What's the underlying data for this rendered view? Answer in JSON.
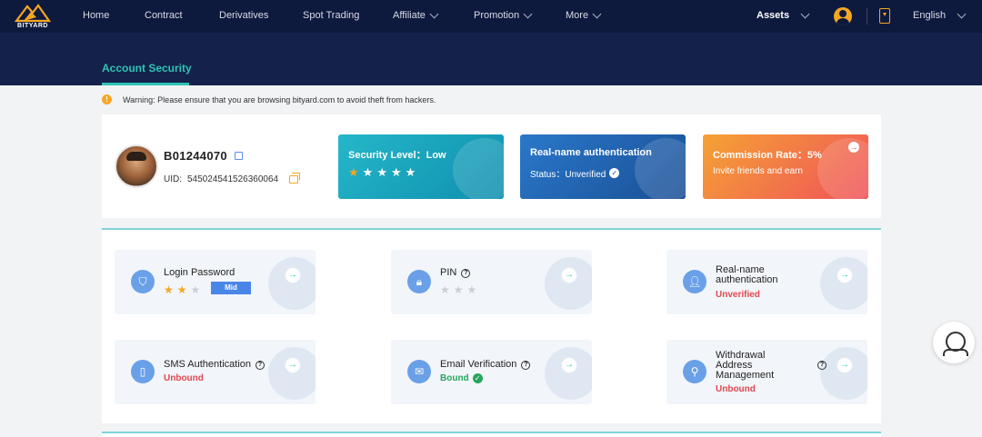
{
  "brand": {
    "name": "BITYARD",
    "logo_icon": "mountain-logo-icon",
    "accent": "#f5a623"
  },
  "nav": {
    "items": [
      {
        "label": "Home",
        "has_dropdown": false
      },
      {
        "label": "Contract",
        "has_dropdown": false
      },
      {
        "label": "Derivatives",
        "has_dropdown": false
      },
      {
        "label": "Spot Trading",
        "has_dropdown": false
      },
      {
        "label": "Affiliate",
        "has_dropdown": true
      },
      {
        "label": "Promotion",
        "has_dropdown": true
      },
      {
        "label": "More",
        "has_dropdown": true
      }
    ],
    "assets_label": "Assets",
    "language": "English"
  },
  "subheader": {
    "active_tab": "Account Security",
    "accent": "#2ec4b6"
  },
  "warning": {
    "text": "Warning: Please ensure that you are browsing bityard.com to avoid theft from hackers.",
    "icon": "warning-icon"
  },
  "profile": {
    "username": "B01244070",
    "uid_label": "UID:",
    "uid_value": "5450245415263600​64"
  },
  "banners": {
    "security": {
      "title": "Security Level：Low",
      "stars_filled": 1,
      "stars_total": 5
    },
    "realname": {
      "title": "Real-name authentication",
      "status": "Status：Unverified"
    },
    "commission": {
      "title": "Commission Rate：5%",
      "subtitle": "Invite friends and earn"
    }
  },
  "tiles": {
    "login_password": {
      "title": "Login Password",
      "stars_filled": 2,
      "stars_total": 3,
      "level": "Mid",
      "icon": "shield-icon"
    },
    "pin": {
      "title": "PIN",
      "stars_filled": 0,
      "stars_total": 3,
      "icon": "lock-icon"
    },
    "realname": {
      "title_line1": "Real-name",
      "title_line2": "authentication",
      "status": "Unverified",
      "icon": "user-icon"
    },
    "sms": {
      "title": "SMS Authentication",
      "status": "Unbound",
      "icon": "phone-icon"
    },
    "email": {
      "title": "Email Verification",
      "status": "Bound",
      "icon": "mail-icon"
    },
    "withdrawal": {
      "title_line1": "Withdrawal",
      "title_line2": "Address",
      "title_line3": "Management",
      "status": "Unbound",
      "icon": "location-icon"
    }
  },
  "colors": {
    "nav_bg": "#0e1a3d",
    "sub_bg": "#14214a",
    "unverified": "#e0484e",
    "bound": "#26a65b"
  }
}
